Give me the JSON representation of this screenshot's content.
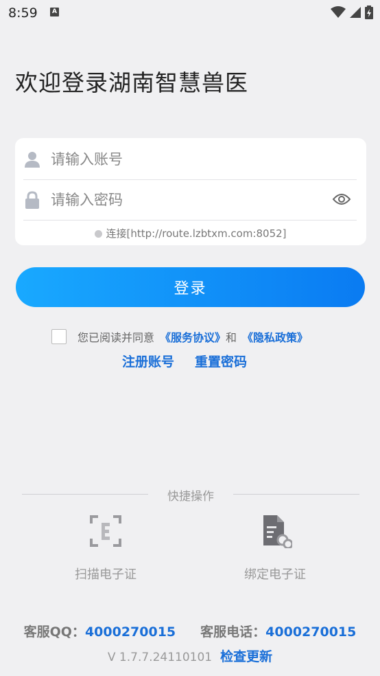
{
  "status_bar": {
    "time": "8:59",
    "notification_icon": "A"
  },
  "welcome_title": "欢迎登录湖南智慧兽医",
  "login_form": {
    "account_placeholder": "请输入账号",
    "password_placeholder": "请输入密码",
    "connection_text": "连接[http://route.lzbtxm.com:8052]"
  },
  "login_button": "登录",
  "agreement": {
    "text": "您已阅读并同意",
    "service_link": "《服务协议》",
    "and": "和",
    "privacy_link": "《隐私政策》"
  },
  "register_link": "注册账号",
  "reset_password_link": "重置密码",
  "quick_actions": {
    "title": "快捷操作",
    "items": [
      {
        "label": "扫描电子证",
        "icon": "scan-icon"
      },
      {
        "label": "绑定电子证",
        "icon": "bind-document-icon"
      }
    ]
  },
  "customer_service": {
    "qq_label": "客服QQ：",
    "qq_number": "4000270015",
    "phone_label": "客服电话：",
    "phone_number": "4000270015"
  },
  "version": {
    "text": "V 1.7.7.24110101",
    "check_update": "检查更新"
  },
  "colors": {
    "accent": "#1a6fd8",
    "button_start": "#19a9ff",
    "button_end": "#0a7bf2",
    "background": "#f0f0f2"
  }
}
